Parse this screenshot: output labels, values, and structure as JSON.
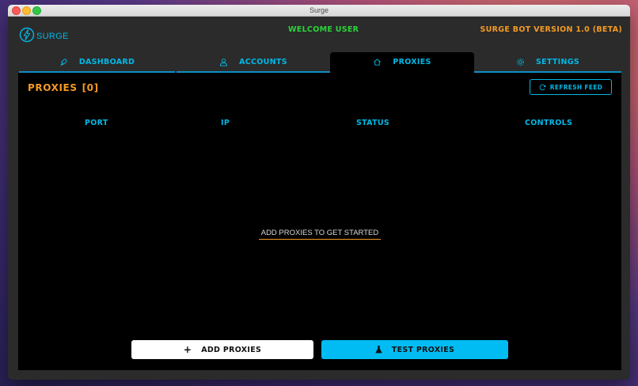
{
  "window": {
    "title": "Surge"
  },
  "header": {
    "logo_text": "SURGE",
    "welcome": "WELCOME USER",
    "version": "SURGE BOT VERSION 1.0 (BETA)"
  },
  "tabs": [
    {
      "label": "DASHBOARD",
      "icon": "rocket-icon",
      "active": false
    },
    {
      "label": "ACCOUNTS",
      "icon": "user-icon",
      "active": false
    },
    {
      "label": "PROXIES",
      "icon": "home-icon",
      "active": true
    },
    {
      "label": "SETTINGS",
      "icon": "gear-icon",
      "active": false
    }
  ],
  "proxies": {
    "title": "PROXIES",
    "count": "[0]",
    "refresh_label": "REFRESH FEED",
    "columns": [
      "PORT",
      "IP",
      "STATUS",
      "CONTROLS"
    ],
    "empty_message": "ADD PROXIES TO GET STARTED",
    "add_label": "ADD PROXIES",
    "test_label": "TEST PROXIES"
  },
  "colors": {
    "accent_blue": "#00b8e6",
    "accent_orange": "#f59a23",
    "welcome_green": "#2ad43a",
    "panel_bg": "#000000",
    "window_bg": "#2b2b2b"
  }
}
